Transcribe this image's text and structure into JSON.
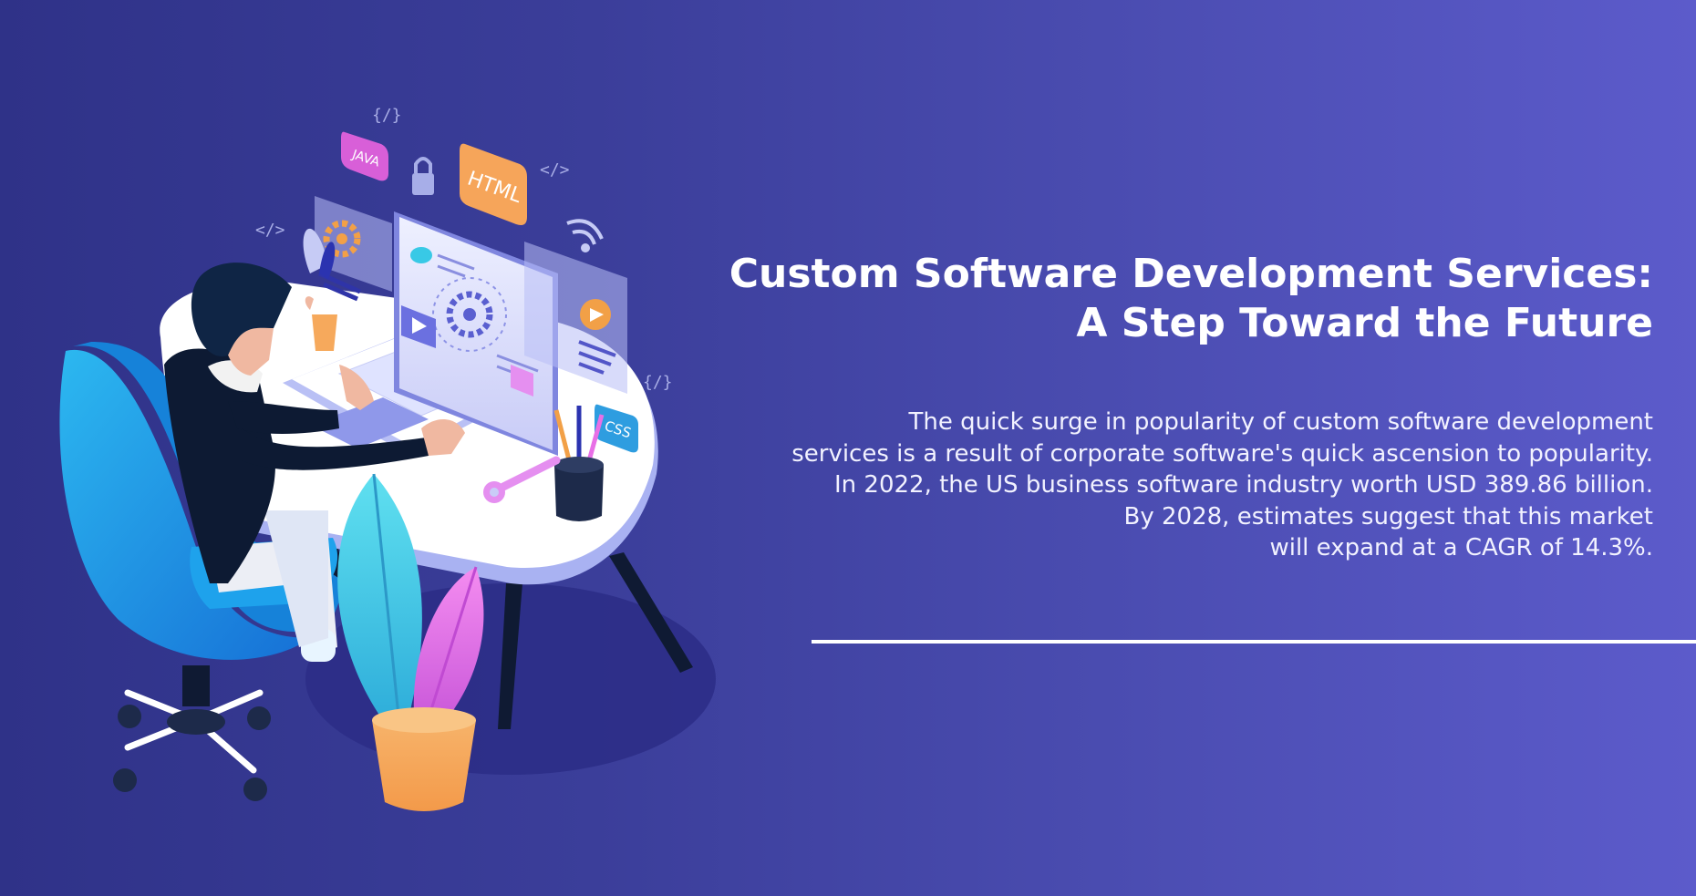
{
  "headline": {
    "line1": "Custom Software Development Services:",
    "line2": "A Step Toward the Future"
  },
  "body": {
    "lines": [
      "The quick surge in popularity of custom software development",
      "services is a result of corporate software's quick ascension to popularity.",
      "In 2022, the US business software industry worth USD 389.86 billion.",
      "By 2028, estimates suggest that this market",
      "will expand at a CAGR of 14.3%."
    ]
  },
  "illustration": {
    "badges": {
      "java": "JAVA",
      "html": "HTML",
      "css": "CSS"
    },
    "code_glyphs": [
      "{/}",
      "</>",
      "</>",
      "{/}"
    ]
  },
  "colors": {
    "background_start": "#2f3288",
    "background_end": "#5c5bcb",
    "chair": "#1fa0e8",
    "plant_cyan": "#44d0e6",
    "plant_pink": "#e86fe6",
    "pot": "#f6a95c",
    "html_badge": "#f6a55a",
    "java_badge": "#d85fd8",
    "css_badge": "#2e9de0"
  }
}
